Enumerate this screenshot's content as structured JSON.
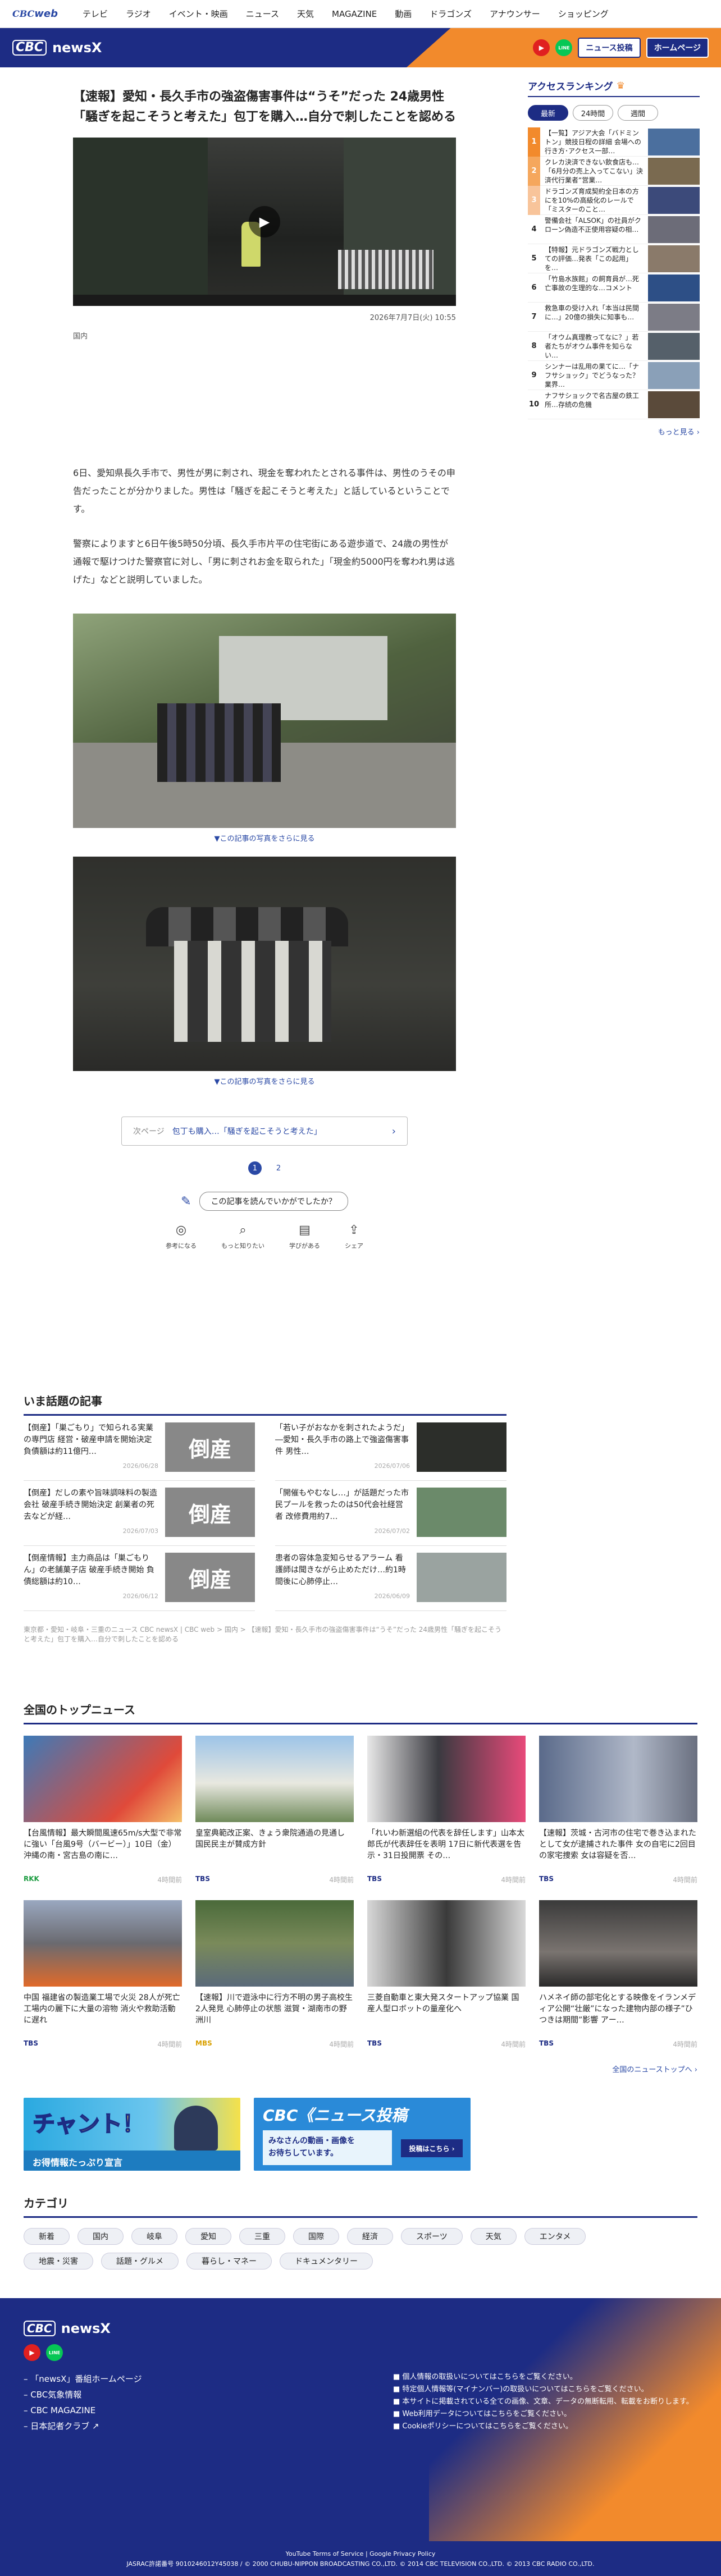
{
  "topnav": {
    "logo_main": "CBC",
    "logo_sub": "web",
    "items": [
      "テレビ",
      "ラジオ",
      "イベント・映画",
      "ニュース",
      "天気",
      "MAGAZINE",
      "動画",
      "ドラゴンズ",
      "アナウンサー",
      "ショッピング"
    ]
  },
  "header": {
    "logo_cbc": "CBC",
    "logo_news": "newsX",
    "youtube": "▶",
    "line": "LINE",
    "post_button": "ニュース投稿",
    "home_button": "ホームページ"
  },
  "article": {
    "title": "【速報】愛知・長久手市の強盗傷害事件は“うそ”だった 24歳男性「騒ぎを起こそうと考えた」包丁を購入…自分で刺したことを認める",
    "date": "2026年7月7日(火) 10:55",
    "category": "国内",
    "paragraph1": "6日、愛知県長久手市で、男性が男に刺され、現金を奪われたとされる事件は、男性のうその申告だったことが分かりました。男性は「騒ぎを起こそうと考えた」と話しているということです。",
    "paragraph2": "警察によりますと6日午後5時50分頃、長久手市片平の住宅街にある遊歩道で、24歳の男性が通報で駆けつけた警察官に対し、「男に刺されお金を取られた」「現金約5000円を奪われ男は逃げた」などと説明していました。",
    "photo_caption_1": "▼この記事の写真をさらに見る",
    "photo_caption_2": "▼この記事の写真をさらに見る",
    "next_label": "次ページ",
    "next_text": "包丁も購入…「騒ぎを起こそうと考えた」",
    "pages": [
      "1",
      "2"
    ],
    "survey_question": "この記事を読んでいかがでしたか？",
    "reactions": [
      {
        "label": "参考になる",
        "icon": "bulb-icon",
        "glyph": "◎"
      },
      {
        "label": "もっと知りたい",
        "icon": "search-icon",
        "glyph": "⌕"
      },
      {
        "label": "学びがある",
        "icon": "book-icon",
        "glyph": "▤"
      },
      {
        "label": "シェア",
        "icon": "share-icon",
        "glyph": "⇪"
      }
    ]
  },
  "ranking": {
    "title": "アクセスランキング",
    "tabs": [
      "最新",
      "24時間",
      "週間"
    ],
    "items": [
      {
        "rank": "1",
        "text": "【一覧】アジア大会「バドミントン」競技日程の詳細 会場への行き方･アクセス一部…"
      },
      {
        "rank": "2",
        "text": "クレカ決済できない飲食店も…「6月分の売上入ってこない」決済代行業者“営業…"
      },
      {
        "rank": "3",
        "text": "ドラゴンズ育成契約全日本の方にを10%の高級化のレールで「ミスターのこと…"
      },
      {
        "rank": "4",
        "text": "警備会社「ALSOK」の社員がクローン偽造不正使用容疑の相…"
      },
      {
        "rank": "5",
        "text": "【特報】元ドラゴンズ戦力としての評価…発表「この起用」を…"
      },
      {
        "rank": "6",
        "text": "「竹島水族館」の飼育員が…死亡事故の生理的な…コメント"
      },
      {
        "rank": "7",
        "text": "救急車の受け入れ「本当は民間に…」20億の損失に知事も…"
      },
      {
        "rank": "8",
        "text": "「オウム真理教ってなに？」若者たちがオウム事件を知らない…"
      },
      {
        "rank": "9",
        "text": "シンナーは乱用の果てに…「ナフサショック」でどうなった？業界…"
      },
      {
        "rank": "10",
        "text": "ナフサショックで名古屋の鉄工所…存続の危機"
      }
    ],
    "more": "もっと見る ›"
  },
  "topics": {
    "title": "いま話題の記事",
    "items": [
      {
        "text": "【倒産】「巣ごもり」で知られる実業の専門店 経営・破産申請を開始決定 負債額は約11億円…",
        "date": "2026/06/28",
        "thumb": "倒産"
      },
      {
        "text": "「若い子がおなかを刺されたようだ」―愛知・長久手市の路上で強盗傷害事件 男性…",
        "date": "2026/07/06",
        "thumb": ""
      },
      {
        "text": "【倒産】だしの素や旨味調味料の製造会社 破産手続き開始決定 創業者の死去などが経…",
        "date": "2026/07/03",
        "thumb": "倒産"
      },
      {
        "text": "「開催もやむなし…」が話題だった市民プールを救ったのは50代会社経営者 改修費用約7…",
        "date": "2026/07/02",
        "thumb": ""
      },
      {
        "text": "【倒産情報】主力商品は「巣ごもりん」の老舗菓子店 破産手続き開始 負債総額は約10…",
        "date": "2026/06/12",
        "thumb": "倒産"
      },
      {
        "text": "患者の容体急変知らせるアラーム 看護師は聞きながら止めただけ…約1時間後に心肺停止…",
        "date": "2026/06/09",
        "thumb": ""
      }
    ]
  },
  "breadcrumb": "東京都・愛知・岐阜・三重のニュース CBC newsX | CBC web > 国内 > 【速報】愛知・長久手市の強盗傷害事件は“うそ”だった 24歳男性「騒ぎを起こそうと考えた」包丁を購入…自分で刺したことを認める",
  "national": {
    "title": "全国のトップニュース",
    "items": [
      {
        "text": "【台風情報】最大瞬間風速65m/s大型で非常に強い「台風9号（バービー）」10日（金）沖縄の南・宮古島の南に…",
        "source": "RKK",
        "source_color": "#1a9b3f",
        "time": "4時間前"
      },
      {
        "text": "皇室典範改正案、きょう衆院通過の見通し 国民民主が賛成方針",
        "source": "TBS",
        "source_color": "#1d2c84",
        "time": "4時間前"
      },
      {
        "text": "「れいわ新選組の代表を辞任します」山本太郎氏が代表辞任を表明 17日に新代表選を告示・31日投開票 その…",
        "source": "TBS",
        "source_color": "#1d2c84",
        "time": "4時間前"
      },
      {
        "text": "【速報】茨城・古河市の住宅で巻き込まれたとして女が逮捕された事件 女の自宅に2回目の家宅捜索 女は容疑を否…",
        "source": "TBS",
        "source_color": "#1d2c84",
        "time": "4時間前"
      },
      {
        "text": "中国 福建省の製造業工場で火災 28人が死亡 工場内の麗下に大量の溶物 消火や救助活動に遅れ",
        "source": "TBS",
        "source_color": "#1d2c84",
        "time": "4時間前"
      },
      {
        "text": "【速報】川で遊泳中に行方不明の男子高校生2人発見 心肺停止の状態 滋賀・湖南市の野洲川",
        "source": "MBS",
        "source_color": "#d9a000",
        "time": "4時間前"
      },
      {
        "text": "三菱自動車と東大発スタートアップ協業 国産人型ロボットの量産化へ",
        "source": "TBS",
        "source_color": "#1d2c84",
        "time": "4時間前"
      },
      {
        "text": "ハメネイ師の部宅化とする映像をイランメディア公開“壮厳”になった建物内部の様子”ひつきは期間”影響 アー…",
        "source": "TBS",
        "source_color": "#1d2c84",
        "time": "4時間前"
      }
    ],
    "more": "全国のニューストップへ ›"
  },
  "banners": {
    "chant_title": "チャント！",
    "chant_sub": "お得情報たっぷり宣言",
    "post_title": "CBC《ニュース投稿",
    "post_sub": "みなさんの動画・画像を\nお待ちしています。",
    "post_cta": "投稿はこちら ›"
  },
  "categories": {
    "title": "カテゴリ",
    "items": [
      "新着",
      "国内",
      "岐阜",
      "愛知",
      "三重",
      "国際",
      "経済",
      "スポーツ",
      "天気",
      "エンタメ",
      "地震・災害",
      "話題・グルメ",
      "暮らし・マネー",
      "ドキュメンタリー"
    ]
  },
  "footer": {
    "logo_cbc": "CBC",
    "logo_news": "newsX",
    "links": [
      "「newsX」番組ホームページ",
      "CBC気象情報",
      "CBC MAGAZINE",
      "日本記者クラブ ↗"
    ],
    "policies": [
      "個人情報の取扱いについてはこちらをご覧ください。",
      "特定個人情報等(マイナンバー)の取扱いについてはこちらをご覧ください。",
      "本サイトに掲載されている全ての画像、文章、データの無断転用、転載をお断りします。",
      "Web利用データについてはこちらをご覧ください。",
      "Cookieポリシーについてはこちらをご覧ください。"
    ],
    "bottom1": "YouTube Terms of Service | Google Privacy Policy",
    "bottom2": "JASRAC許諾番号 9010246012Y45038 / © 2000 CHUBU-NIPPON BROADCASTING CO.,LTD. © 2014 CBC TELEVISION CO.,LTD. © 2013 CBC RADIO CO.,LTD."
  },
  "colors": {
    "brand": "#1d2c84",
    "accent": "#f28a2c",
    "link": "#2a49a5"
  }
}
